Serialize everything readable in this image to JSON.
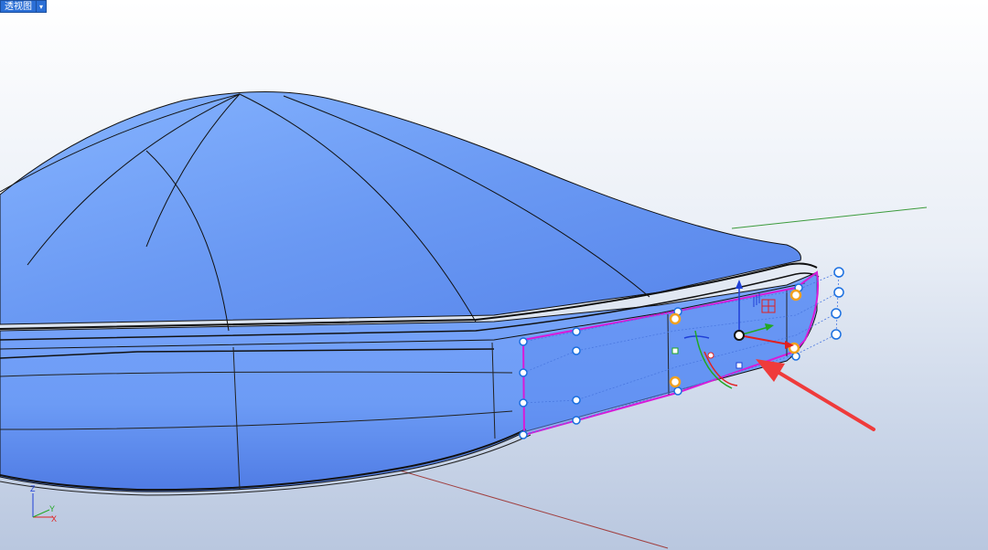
{
  "viewport": {
    "title": "透视图",
    "menu_glyph": "▾"
  },
  "axes": {
    "z_label": "Z",
    "y_label": "Y",
    "x_label": "X"
  },
  "colors": {
    "surface": "#6b9bf5",
    "surface_dark": "#4f7fe8",
    "highlight_curve": "#d81bd8",
    "gumball_x": "#e02020",
    "gumball_y": "#22a822",
    "gumball_z": "#1f3fd6",
    "annotation_arrow": "#ef3b3b",
    "control_point": "#1a6fe0",
    "selected_point": "#f0a020"
  }
}
